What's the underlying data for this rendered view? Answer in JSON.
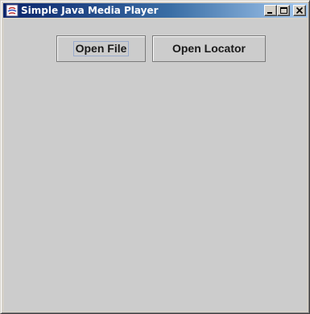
{
  "window": {
    "title": "Simple Java Media Player",
    "controls": {
      "minimize": "minimize-icon",
      "maximize": "maximize-icon",
      "close": "close-icon"
    }
  },
  "toolbar": {
    "open_file_label": "Open File",
    "open_locator_label": "Open Locator"
  },
  "colors": {
    "titlebar_start": "#0a246a",
    "titlebar_end": "#a6caf0",
    "content_background": "#cccccc",
    "frame": "#d4d0c8"
  },
  "icons": {
    "app": "java-app-icon"
  }
}
